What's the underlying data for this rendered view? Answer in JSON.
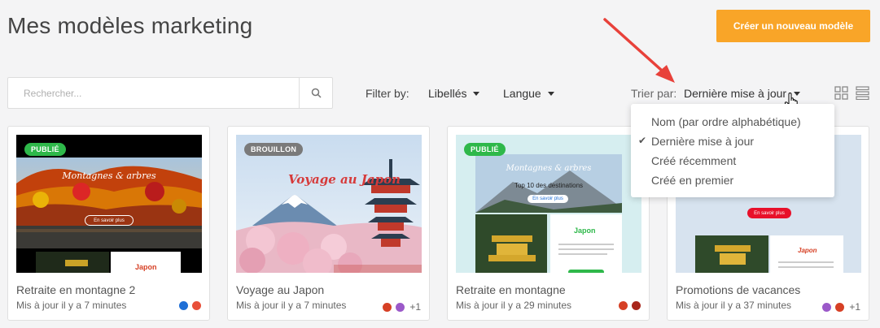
{
  "page": {
    "title": "Mes modèles marketing"
  },
  "header": {
    "create_button": "Créer un nouveau modèle"
  },
  "search": {
    "placeholder": "Rechercher..."
  },
  "filters": {
    "label": "Filter by:",
    "tags": "Libellés",
    "language": "Langue"
  },
  "sort": {
    "label": "Trier par:",
    "selected": "Dernière mise à jour",
    "options": [
      {
        "label": "Nom (par ordre alphabétique)",
        "checked": false
      },
      {
        "label": "Dernière mise à jour",
        "checked": true
      },
      {
        "label": "Créé récemment",
        "checked": false
      },
      {
        "label": "Créé en premier",
        "checked": false
      }
    ]
  },
  "view_icons": [
    "grid-view-icon",
    "list-view-icon"
  ],
  "cards": [
    {
      "name": "Retraite en montagne 2",
      "updated": "Mis à jour il y a 7 minutes",
      "status": "PUBLIÉ",
      "status_color": "#2eb84a",
      "thumb": {
        "heading": "Montagnes & arbres",
        "button": "En savoir plus",
        "sub": "Japon"
      },
      "tag_colors": [
        "#1f6fd6",
        "#e8503a"
      ],
      "extra_tags": ""
    },
    {
      "name": "Voyage au Japon",
      "updated": "Mis à jour il y a 7 minutes",
      "status": "BROUILLON",
      "status_color": "#7a7a7a",
      "thumb": {
        "heading": "Voyage au Japon"
      },
      "tag_colors": [
        "#d64025",
        "#9b59c9"
      ],
      "extra_tags": "+1"
    },
    {
      "name": "Retraite en montagne",
      "updated": "Mis à jour il y a 29 minutes",
      "status": "PUBLIÉ",
      "status_color": "#2eb84a",
      "thumb": {
        "heading": "Montagnes & arbres",
        "subheading": "Top 10 des destinations",
        "button": "En savoir plus",
        "sub": "Japon"
      },
      "tag_colors": [
        "#d64025",
        "#a8261b"
      ],
      "extra_tags": ""
    },
    {
      "name": "Promotions de vacances",
      "updated": "Mis à jour il y a 37 minutes",
      "status": "",
      "status_color": "",
      "thumb": {
        "button": "En savoir plus",
        "sub": "Japon"
      },
      "tag_colors": [
        "#9b59c9",
        "#d64025"
      ],
      "extra_tags": "+1"
    }
  ],
  "colors": {
    "accent": "#f9a528",
    "arrow": "#e8413a"
  }
}
